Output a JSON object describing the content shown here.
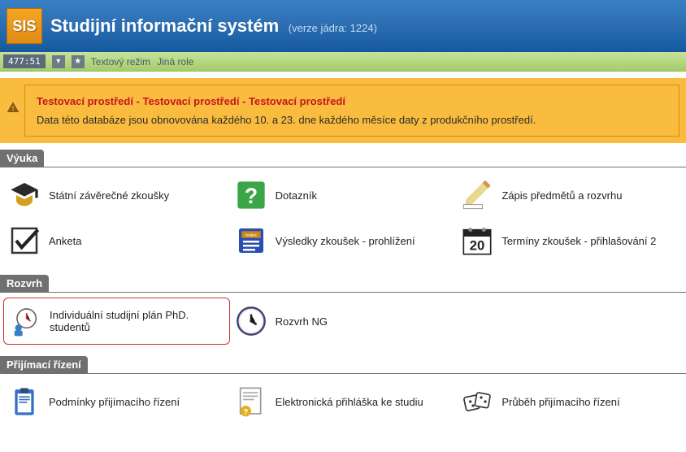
{
  "header": {
    "logo_text": "SIS",
    "title": "Studijní informační systém",
    "version": "(verze jádra: 1224)"
  },
  "toolbar": {
    "time": "477:51",
    "text_mode": "Textový režim",
    "other_role": "Jiná role"
  },
  "warning": {
    "title": "Testovací prostředí - Testovací prostředí - Testovací prostředí",
    "text": "Data této databáze jsou obnovována každého 10. a 23. dne každého měsíce daty z produkčního prostředí."
  },
  "sections": {
    "vyuka": {
      "title": "Výuka",
      "items": [
        {
          "label": "Státní závěrečné zkoušky"
        },
        {
          "label": "Dotazník"
        },
        {
          "label": "Zápis předmětů a rozvrhu"
        },
        {
          "label": "Anketa"
        },
        {
          "label": "Výsledky zkoušek - prohlížení"
        },
        {
          "label": "Termíny zkoušek - přihlašování 2"
        }
      ]
    },
    "rozvrh": {
      "title": "Rozvrh",
      "items": [
        {
          "label": "Individuální studijní plán PhD. studentů"
        },
        {
          "label": "Rozvrh NG"
        }
      ]
    },
    "prijimaci": {
      "title": "Přijímací řízení",
      "items": [
        {
          "label": "Podmínky přijímacího řízení"
        },
        {
          "label": "Elektronická přihláška ke studiu"
        },
        {
          "label": "Průběh přijímacího řízení"
        }
      ]
    }
  }
}
